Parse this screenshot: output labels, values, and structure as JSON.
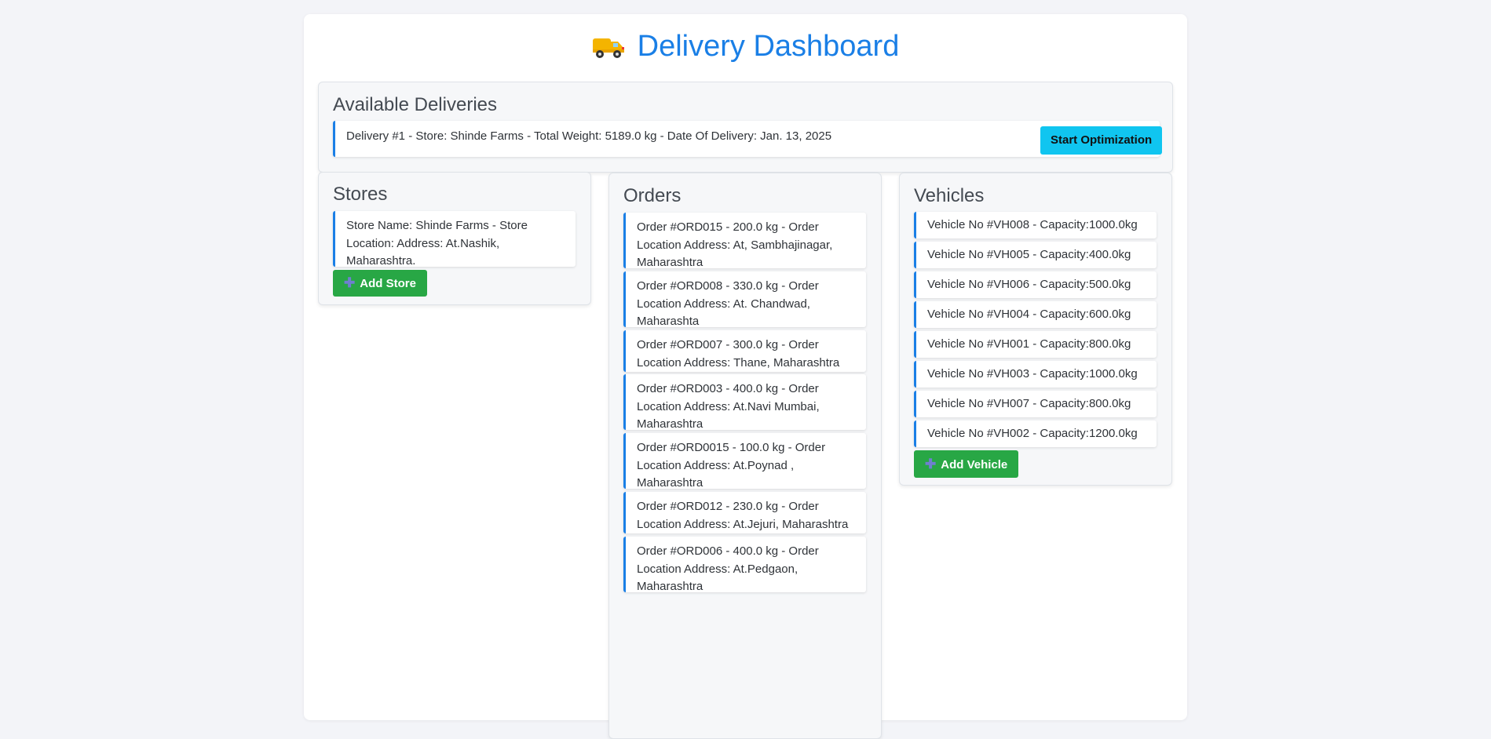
{
  "title": "Delivery Dashboard",
  "deliveries": {
    "heading": "Available Deliveries",
    "items": [
      {
        "text": "Delivery #1 - Store: Shinde Farms - Total Weight: 5189.0 kg - Date Of Delivery: Jan. 13, 2025",
        "button": "Start Optimization"
      }
    ]
  },
  "stores": {
    "heading": "Stores",
    "items": [
      "Store Name: Shinde Farms - Store Location: Address: At.Nashik, Maharashtra."
    ],
    "add_label": "Add Store"
  },
  "orders": {
    "heading": "Orders",
    "items": [
      "Order #ORD015 - 200.0 kg - Order Location Address: At, Sambhajinagar, Maharashtra",
      "Order #ORD008 - 330.0 kg - Order Location Address: At. Chandwad, Maharashta",
      "Order #ORD007 - 300.0 kg - Order Location Address: Thane, Maharashtra",
      "Order #ORD003 - 400.0 kg - Order Location Address: At.Navi Mumbai, Maharashtra",
      "Order #ORD0015 - 100.0 kg - Order Location Address: At.Poynad , Maharashtra",
      "Order #ORD012 - 230.0 kg - Order Location Address: At.Jejuri, Maharashtra",
      "Order #ORD006 - 400.0 kg - Order Location Address: At.Pedgaon, Maharashtra"
    ]
  },
  "vehicles": {
    "heading": "Vehicles",
    "items": [
      "Vehicle No #VH008 - Capacity:1000.0kg",
      "Vehicle No #VH005 - Capacity:400.0kg",
      "Vehicle No #VH006 - Capacity:500.0kg",
      "Vehicle No #VH004 - Capacity:600.0kg",
      "Vehicle No #VH001 - Capacity:800.0kg",
      "Vehicle No #VH003 - Capacity:1000.0kg",
      "Vehicle No #VH007 - Capacity:800.0kg",
      "Vehicle No #VH002 - Capacity:1200.0kg"
    ],
    "add_label": "Add Vehicle"
  },
  "icons": {
    "title": "truck-icon",
    "add": "plus-icon"
  },
  "colors": {
    "accent": "#1a7fe6",
    "success": "#28a745",
    "info": "#10c5f0",
    "background": "#f3f4f8"
  }
}
